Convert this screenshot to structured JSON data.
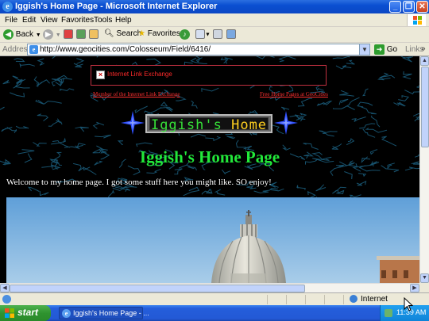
{
  "window": {
    "title": "Iggish's Home Page - Microsoft Internet Explorer",
    "controls": {
      "minimize": "_",
      "maximize": "❐",
      "close": "✕"
    }
  },
  "menu": [
    "File",
    "Edit",
    "View",
    "Favorites",
    "Tools",
    "Help"
  ],
  "toolbar": {
    "back": "Back",
    "search": "Search",
    "favorites": "Favorites"
  },
  "address": {
    "label": "Address",
    "url": "http://www.geocities.com/Colosseum/Field/6416/",
    "go": "Go",
    "links": "Links"
  },
  "page": {
    "banner_text": "Internet Link Exchange",
    "link_left": "Member of the Internet Link Exchange",
    "link_right": "Free Home Pages at GeoCities",
    "logo_part1": "Iggish's",
    "logo_part2": "Home",
    "heading": "Iggish's Home Page",
    "welcome": "Welcome to my home page. I got some stuff here you might like. SO enjoy!"
  },
  "status": {
    "zone": "Internet"
  },
  "taskbar": {
    "start": "start",
    "task_item": "Iggish's Home Page - ...",
    "clock": "11:39 AM"
  },
  "colors": {
    "heading": "#22e83a",
    "link": "#ff3030",
    "xp_blue": "#0a4fd1",
    "start_green": "#2f932f"
  }
}
